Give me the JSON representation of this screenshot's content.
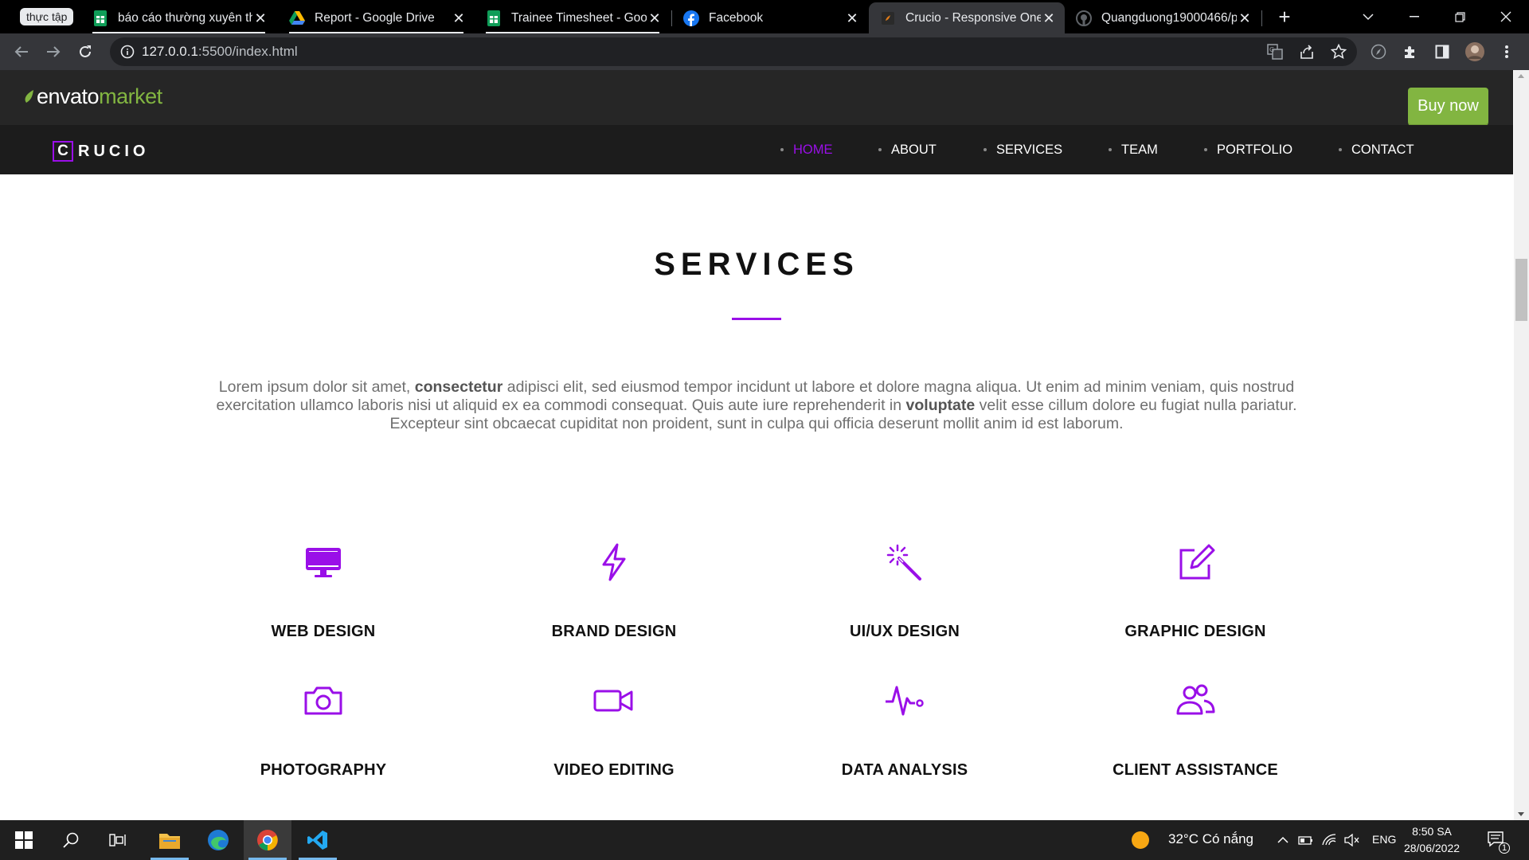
{
  "browser": {
    "tab_group_label": "thực tập",
    "tabs": [
      {
        "title": "báo cáo thường xuyên th",
        "icon": "google-sheets-icon"
      },
      {
        "title": "Report - Google Drive",
        "icon": "google-drive-icon"
      },
      {
        "title": "Trainee Timesheet - Goo",
        "icon": "google-sheets-icon"
      },
      {
        "title": "Facebook",
        "icon": "facebook-icon"
      },
      {
        "title": "Crucio - Responsive One",
        "icon": "crucio-icon",
        "active": true
      },
      {
        "title": "Quangduong19000466/p",
        "icon": "github-icon"
      }
    ],
    "url_host": "127.0.0.1",
    "url_rest": ":5500/index.html"
  },
  "envato": {
    "logo_part1": "envato",
    "logo_part2": "market",
    "buy_now_label": "Buy now",
    "brand_green": "#82b541"
  },
  "site": {
    "brand_letter": "C",
    "brand_word": "RUCIO",
    "accent_color": "#9a0fe8",
    "nav": [
      {
        "label": "HOME",
        "active": true
      },
      {
        "label": "ABOUT"
      },
      {
        "label": "SERVICES"
      },
      {
        "label": "TEAM"
      },
      {
        "label": "PORTFOLIO"
      },
      {
        "label": "CONTACT"
      }
    ]
  },
  "services": {
    "title": "SERVICES",
    "intro": {
      "p1": "Lorem ipsum dolor sit amet, ",
      "b1": "consectetur",
      "p2": " adipisci elit, sed eiusmod tempor incidunt ut labore et dolore magna aliqua. Ut enim ad minim veniam, quis nostrud exercitation ullamco laboris nisi ut aliquid ex ea commodi consequat. Quis aute iure reprehenderit in ",
      "b2": "voluptate",
      "p3": " velit esse cillum dolore eu fugiat nulla pariatur. Excepteur sint obcaecat cupiditat non proident, sunt in culpa qui officia deserunt mollit anim id est laborum."
    },
    "items": [
      {
        "label": "WEB DESIGN",
        "icon": "monitor-icon"
      },
      {
        "label": "BRAND DESIGN",
        "icon": "lightning-icon"
      },
      {
        "label": "UI/UX DESIGN",
        "icon": "magic-wand-icon"
      },
      {
        "label": "GRAPHIC DESIGN",
        "icon": "edit-icon"
      },
      {
        "label": "PHOTOGRAPHY",
        "icon": "camera-icon"
      },
      {
        "label": "VIDEO EDITING",
        "icon": "video-camera-icon"
      },
      {
        "label": "DATA ANALYSIS",
        "icon": "pulse-icon"
      },
      {
        "label": "CLIENT ASSISTANCE",
        "icon": "people-icon"
      }
    ]
  },
  "taskbar": {
    "weather": "32°C  Có nắng",
    "language": "ENG",
    "time": "8:50 SA",
    "date": "28/06/2022",
    "notification_count": "1"
  }
}
